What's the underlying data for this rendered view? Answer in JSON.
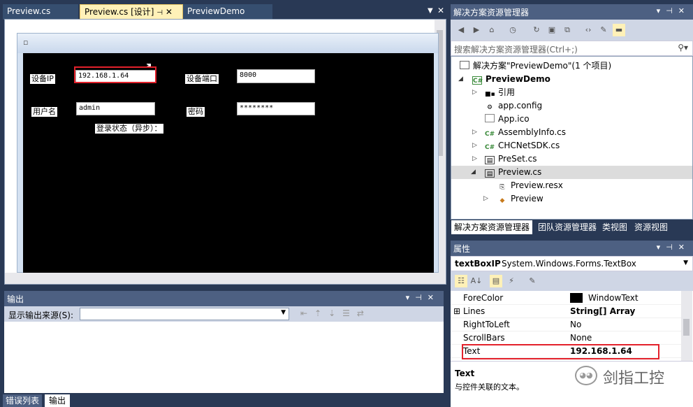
{
  "doc_tabs": [
    "Preview.cs",
    "Preview.cs [设计]",
    "PreviewDemo"
  ],
  "designer": {
    "labels": {
      "ip": "设备IP",
      "port": "设备端口",
      "user": "用户名",
      "pwd": "密码",
      "status": "登录状态（异步）："
    },
    "values": {
      "ip": "192.168.1.64",
      "port": "8000",
      "user": "admin",
      "pwd": "********"
    }
  },
  "output": {
    "title": "输出",
    "source_label": "显示输出来源(S):",
    "source_value": ""
  },
  "bottom_tabs": [
    "错误列表",
    "输出"
  ],
  "solution_explorer": {
    "title": "解决方案资源管理器",
    "search_placeholder": "搜索解决方案资源管理器(Ctrl+;)",
    "tree": [
      {
        "label": "解决方案\"PreviewDemo\"(1 个项目)",
        "icon": "solution-icon"
      },
      {
        "label": "PreviewDemo",
        "icon": "csproj-icon"
      },
      {
        "label": "引用",
        "icon": "references-icon"
      },
      {
        "label": "app.config",
        "icon": "config-icon"
      },
      {
        "label": "App.ico",
        "icon": "ico-icon"
      },
      {
        "label": "AssemblyInfo.cs",
        "icon": "cs-icon"
      },
      {
        "label": "CHCNetSDK.cs",
        "icon": "cs-icon"
      },
      {
        "label": "PreSet.cs",
        "icon": "form-icon"
      },
      {
        "label": "Preview.cs",
        "icon": "form-icon"
      },
      {
        "label": "Preview.resx",
        "icon": "resx-icon"
      },
      {
        "label": "Preview",
        "icon": "class-icon"
      }
    ],
    "tabs": [
      "解决方案资源管理器",
      "团队资源管理器",
      "类视图",
      "资源视图"
    ]
  },
  "properties": {
    "title": "属性",
    "object_name": "textBoxIP",
    "object_type": "System.Windows.Forms.TextBox",
    "rows": [
      {
        "name": "ForeColor",
        "value": "WindowText",
        "expand": ""
      },
      {
        "name": "Lines",
        "value": "String[] Array",
        "expand": "⊞"
      },
      {
        "name": "RightToLeft",
        "value": "No",
        "expand": ""
      },
      {
        "name": "ScrollBars",
        "value": "None",
        "expand": ""
      },
      {
        "name": "Text",
        "value": "192.168.1.64",
        "expand": ""
      }
    ],
    "desc_title": "Text",
    "desc_text": "与控件关联的文本。"
  },
  "watermark": "剑指工控",
  "colors": {
    "bg": "#293955",
    "highlight_red": "#e3212b",
    "active_tab": "#fff1b8"
  }
}
